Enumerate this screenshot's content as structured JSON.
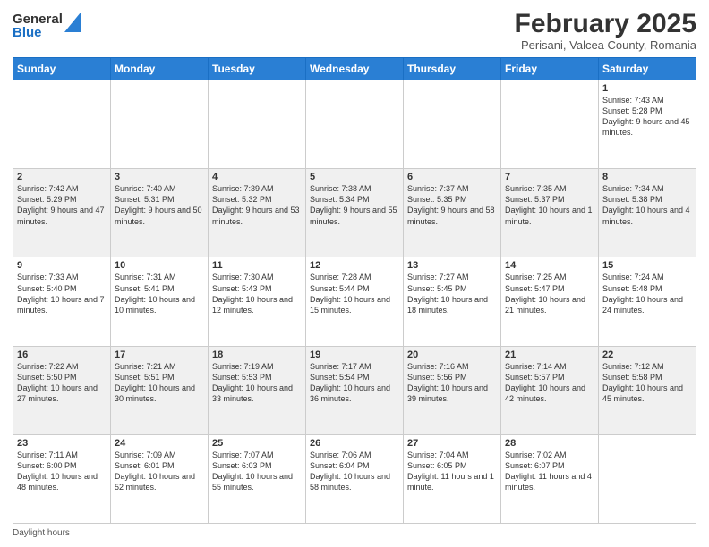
{
  "logo": {
    "general": "General",
    "blue": "Blue"
  },
  "header": {
    "title": "February 2025",
    "subtitle": "Perisani, Valcea County, Romania"
  },
  "days_of_week": [
    "Sunday",
    "Monday",
    "Tuesday",
    "Wednesday",
    "Thursday",
    "Friday",
    "Saturday"
  ],
  "footer": {
    "daylight_label": "Daylight hours"
  },
  "weeks": [
    [
      {
        "day": "",
        "info": ""
      },
      {
        "day": "",
        "info": ""
      },
      {
        "day": "",
        "info": ""
      },
      {
        "day": "",
        "info": ""
      },
      {
        "day": "",
        "info": ""
      },
      {
        "day": "",
        "info": ""
      },
      {
        "day": "1",
        "info": "Sunrise: 7:43 AM\nSunset: 5:28 PM\nDaylight: 9 hours and 45 minutes."
      }
    ],
    [
      {
        "day": "2",
        "info": "Sunrise: 7:42 AM\nSunset: 5:29 PM\nDaylight: 9 hours and 47 minutes."
      },
      {
        "day": "3",
        "info": "Sunrise: 7:40 AM\nSunset: 5:31 PM\nDaylight: 9 hours and 50 minutes."
      },
      {
        "day": "4",
        "info": "Sunrise: 7:39 AM\nSunset: 5:32 PM\nDaylight: 9 hours and 53 minutes."
      },
      {
        "day": "5",
        "info": "Sunrise: 7:38 AM\nSunset: 5:34 PM\nDaylight: 9 hours and 55 minutes."
      },
      {
        "day": "6",
        "info": "Sunrise: 7:37 AM\nSunset: 5:35 PM\nDaylight: 9 hours and 58 minutes."
      },
      {
        "day": "7",
        "info": "Sunrise: 7:35 AM\nSunset: 5:37 PM\nDaylight: 10 hours and 1 minute."
      },
      {
        "day": "8",
        "info": "Sunrise: 7:34 AM\nSunset: 5:38 PM\nDaylight: 10 hours and 4 minutes."
      }
    ],
    [
      {
        "day": "9",
        "info": "Sunrise: 7:33 AM\nSunset: 5:40 PM\nDaylight: 10 hours and 7 minutes."
      },
      {
        "day": "10",
        "info": "Sunrise: 7:31 AM\nSunset: 5:41 PM\nDaylight: 10 hours and 10 minutes."
      },
      {
        "day": "11",
        "info": "Sunrise: 7:30 AM\nSunset: 5:43 PM\nDaylight: 10 hours and 12 minutes."
      },
      {
        "day": "12",
        "info": "Sunrise: 7:28 AM\nSunset: 5:44 PM\nDaylight: 10 hours and 15 minutes."
      },
      {
        "day": "13",
        "info": "Sunrise: 7:27 AM\nSunset: 5:45 PM\nDaylight: 10 hours and 18 minutes."
      },
      {
        "day": "14",
        "info": "Sunrise: 7:25 AM\nSunset: 5:47 PM\nDaylight: 10 hours and 21 minutes."
      },
      {
        "day": "15",
        "info": "Sunrise: 7:24 AM\nSunset: 5:48 PM\nDaylight: 10 hours and 24 minutes."
      }
    ],
    [
      {
        "day": "16",
        "info": "Sunrise: 7:22 AM\nSunset: 5:50 PM\nDaylight: 10 hours and 27 minutes."
      },
      {
        "day": "17",
        "info": "Sunrise: 7:21 AM\nSunset: 5:51 PM\nDaylight: 10 hours and 30 minutes."
      },
      {
        "day": "18",
        "info": "Sunrise: 7:19 AM\nSunset: 5:53 PM\nDaylight: 10 hours and 33 minutes."
      },
      {
        "day": "19",
        "info": "Sunrise: 7:17 AM\nSunset: 5:54 PM\nDaylight: 10 hours and 36 minutes."
      },
      {
        "day": "20",
        "info": "Sunrise: 7:16 AM\nSunset: 5:56 PM\nDaylight: 10 hours and 39 minutes."
      },
      {
        "day": "21",
        "info": "Sunrise: 7:14 AM\nSunset: 5:57 PM\nDaylight: 10 hours and 42 minutes."
      },
      {
        "day": "22",
        "info": "Sunrise: 7:12 AM\nSunset: 5:58 PM\nDaylight: 10 hours and 45 minutes."
      }
    ],
    [
      {
        "day": "23",
        "info": "Sunrise: 7:11 AM\nSunset: 6:00 PM\nDaylight: 10 hours and 48 minutes."
      },
      {
        "day": "24",
        "info": "Sunrise: 7:09 AM\nSunset: 6:01 PM\nDaylight: 10 hours and 52 minutes."
      },
      {
        "day": "25",
        "info": "Sunrise: 7:07 AM\nSunset: 6:03 PM\nDaylight: 10 hours and 55 minutes."
      },
      {
        "day": "26",
        "info": "Sunrise: 7:06 AM\nSunset: 6:04 PM\nDaylight: 10 hours and 58 minutes."
      },
      {
        "day": "27",
        "info": "Sunrise: 7:04 AM\nSunset: 6:05 PM\nDaylight: 11 hours and 1 minute."
      },
      {
        "day": "28",
        "info": "Sunrise: 7:02 AM\nSunset: 6:07 PM\nDaylight: 11 hours and 4 minutes."
      },
      {
        "day": "",
        "info": ""
      }
    ]
  ]
}
